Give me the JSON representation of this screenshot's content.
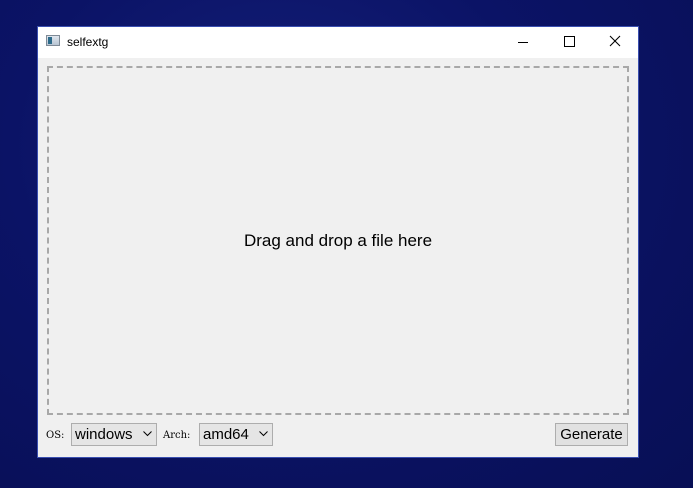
{
  "window": {
    "title": "selfextg"
  },
  "titlebar": {
    "icons": {
      "app": "app-icon",
      "minimize": "minimize-icon",
      "maximize": "maximize-icon",
      "close": "close-icon"
    }
  },
  "drop_zone": {
    "text": "Drag and drop a file here"
  },
  "controls": {
    "os_label": "OS:",
    "os_value": "windows",
    "arch_label": "Arch:",
    "arch_value": "amd64",
    "generate_label": "Generate"
  },
  "colors": {
    "desktop": "#0b1366",
    "window_bg": "#f0f0f0",
    "titlebar_bg": "#ffffff",
    "dashed_border": "#a8a8a8"
  }
}
